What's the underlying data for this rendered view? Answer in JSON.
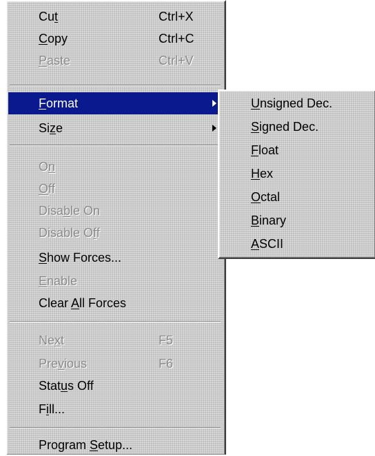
{
  "menu": {
    "cut": {
      "pre": "Cu",
      "key": "t",
      "post": "",
      "shortcut": "Ctrl+X"
    },
    "copy": {
      "pre": "",
      "key": "C",
      "post": "opy",
      "shortcut": "Ctrl+C"
    },
    "paste": {
      "pre": "",
      "key": "P",
      "post": "aste",
      "shortcut": "Ctrl+V"
    },
    "format": {
      "pre": "",
      "key": "F",
      "post": "ormat"
    },
    "size": {
      "pre": "Si",
      "key": "z",
      "post": "e"
    },
    "on": {
      "pre": "O",
      "key": "n",
      "post": ""
    },
    "off": {
      "pre": "",
      "key": "O",
      "post": "ff"
    },
    "disable_on": {
      "pre": "Disa",
      "key": "b",
      "post": "le On"
    },
    "disable_off": {
      "pre": "Disable O",
      "key": "f",
      "post": "f"
    },
    "show_forces": {
      "pre": "",
      "key": "S",
      "post": "how Forces..."
    },
    "enable": {
      "pre": "",
      "key": "E",
      "post": "nable"
    },
    "clear_all_forces": {
      "pre": "Clear ",
      "key": "A",
      "post": "ll Forces"
    },
    "next": {
      "pre": "Ne",
      "key": "x",
      "post": "t",
      "shortcut": "F5"
    },
    "previous": {
      "pre": "Pre",
      "key": "v",
      "post": "ious",
      "shortcut": "F6"
    },
    "status_off": {
      "pre": "Stat",
      "key": "u",
      "post": "s Off"
    },
    "fill": {
      "pre": "F",
      "key": "i",
      "post": "ll..."
    },
    "program_setup": {
      "pre": "Program ",
      "key": "S",
      "post": "etup..."
    }
  },
  "format_submenu": {
    "unsigned_dec": {
      "pre": "",
      "key": "U",
      "post": "nsigned Dec."
    },
    "signed_dec": {
      "pre": "",
      "key": "S",
      "post": "igned Dec."
    },
    "float": {
      "pre": "",
      "key": "F",
      "post": "loat"
    },
    "hex": {
      "pre": "",
      "key": "H",
      "post": "ex"
    },
    "octal": {
      "pre": "",
      "key": "O",
      "post": "ctal"
    },
    "binary": {
      "pre": "",
      "key": "B",
      "post": "inary"
    },
    "ascii": {
      "pre": "",
      "key": "A",
      "post": "SCII"
    }
  },
  "colors": {
    "menu_bg": "#c0c0c0",
    "highlight": "#0a1a8e",
    "disabled_text": "#8a8a8a"
  }
}
